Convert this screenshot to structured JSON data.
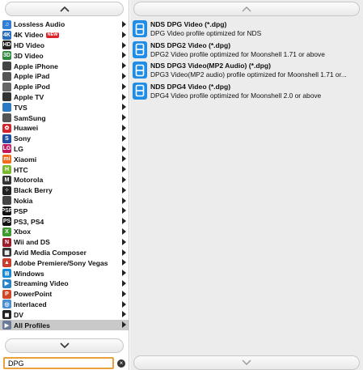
{
  "categories": [
    {
      "label": "Lossless Audio",
      "icon": "music-note-icon",
      "color": "#2f7fd6",
      "glyph": "♫"
    },
    {
      "label": "4K Video",
      "icon": "4k-icon",
      "color": "#2a6fbf",
      "glyph": "4K",
      "badge": "NEW"
    },
    {
      "label": "HD Video",
      "icon": "hd-icon",
      "color": "#222222",
      "glyph": "HD"
    },
    {
      "label": "3D Video",
      "icon": "3d-icon",
      "color": "#2e8b3e",
      "glyph": "3D"
    },
    {
      "label": "Apple iPhone",
      "icon": "iphone-icon",
      "color": "#444444",
      "glyph": ""
    },
    {
      "label": "Apple iPad",
      "icon": "ipad-icon",
      "color": "#555555",
      "glyph": ""
    },
    {
      "label": "Apple iPod",
      "icon": "ipod-icon",
      "color": "#666666",
      "glyph": ""
    },
    {
      "label": "Apple TV",
      "icon": "apple-tv-icon",
      "color": "#333333",
      "glyph": ""
    },
    {
      "label": "TVS",
      "icon": "tv-icon",
      "color": "#2b7bc4",
      "glyph": ""
    },
    {
      "label": "SamSung",
      "icon": "samsung-phone-icon",
      "color": "#555555",
      "glyph": ""
    },
    {
      "label": "Huawei",
      "icon": "huawei-icon",
      "color": "#d3242c",
      "glyph": "✿"
    },
    {
      "label": "Sony",
      "icon": "sony-icon",
      "color": "#1d4ea3",
      "glyph": "S"
    },
    {
      "label": "LG",
      "icon": "lg-icon",
      "color": "#c0175d",
      "glyph": "LG"
    },
    {
      "label": "Xiaomi",
      "icon": "xiaomi-icon",
      "color": "#f26b1d",
      "glyph": "mi"
    },
    {
      "label": "HTC",
      "icon": "htc-icon",
      "color": "#7cb82f",
      "glyph": "H"
    },
    {
      "label": "Motorola",
      "icon": "motorola-icon",
      "color": "#333333",
      "glyph": "M"
    },
    {
      "label": "Black Berry",
      "icon": "blackberry-icon",
      "color": "#222222",
      "glyph": "⁘"
    },
    {
      "label": "Nokia",
      "icon": "nokia-icon",
      "color": "#444444",
      "glyph": ""
    },
    {
      "label": "PSP",
      "icon": "psp-icon",
      "color": "#111111",
      "glyph": "PSP"
    },
    {
      "label": "PS3, PS4",
      "icon": "playstation-icon",
      "color": "#111111",
      "glyph": "PS"
    },
    {
      "label": "Xbox",
      "icon": "xbox-icon",
      "color": "#3f9b2f",
      "glyph": "X"
    },
    {
      "label": "Wii and DS",
      "icon": "nintendo-icon",
      "color": "#9c1c2c",
      "glyph": "N"
    },
    {
      "label": "Avid Media Composer",
      "icon": "avid-icon",
      "color": "#333333",
      "glyph": "▦"
    },
    {
      "label": "Adobe Premiere/Sony Vegas",
      "icon": "adobe-premiere-icon",
      "color": "#c8402d",
      "glyph": "▲"
    },
    {
      "label": "Windows",
      "icon": "windows-icon",
      "color": "#1a8ad8",
      "glyph": "⊞"
    },
    {
      "label": "Streaming Video",
      "icon": "streaming-icon",
      "color": "#2b83c7",
      "glyph": "▶"
    },
    {
      "label": "PowerPoint",
      "icon": "powerpoint-icon",
      "color": "#d24726",
      "glyph": "P"
    },
    {
      "label": "Interlaced",
      "icon": "interlaced-icon",
      "color": "#4a8fd0",
      "glyph": "◎"
    },
    {
      "label": "DV",
      "icon": "dv-camera-icon",
      "color": "#222222",
      "glyph": "◼"
    },
    {
      "label": "All Profiles",
      "icon": "all-profiles-icon",
      "color": "#6a7a99",
      "glyph": "▶",
      "selected": true
    }
  ],
  "search": {
    "value": "DPG",
    "placeholder": ""
  },
  "profiles": [
    {
      "title": "NDS DPG Video (*.dpg)",
      "desc": "DPG Video profile optimized for NDS"
    },
    {
      "title": "NDS DPG2 Video (*.dpg)",
      "desc": "DPG2 Video profile optimized for Moonshell 1.71 or above"
    },
    {
      "title": "NDS DPG3 Video(MP2 Audio) (*.dpg)",
      "desc": "DPG3 Video(MP2 audio) profile optimized for Moonshell 1.71 or..."
    },
    {
      "title": "NDS DPG4 Video (*.dpg)",
      "desc": "DPG4 Video profile optimized for Moonshell 2.0 or above"
    }
  ],
  "colors": {
    "accent": "#1f8ce6",
    "search_border": "#e9a23b",
    "selected_row": "#c9c9c9"
  }
}
